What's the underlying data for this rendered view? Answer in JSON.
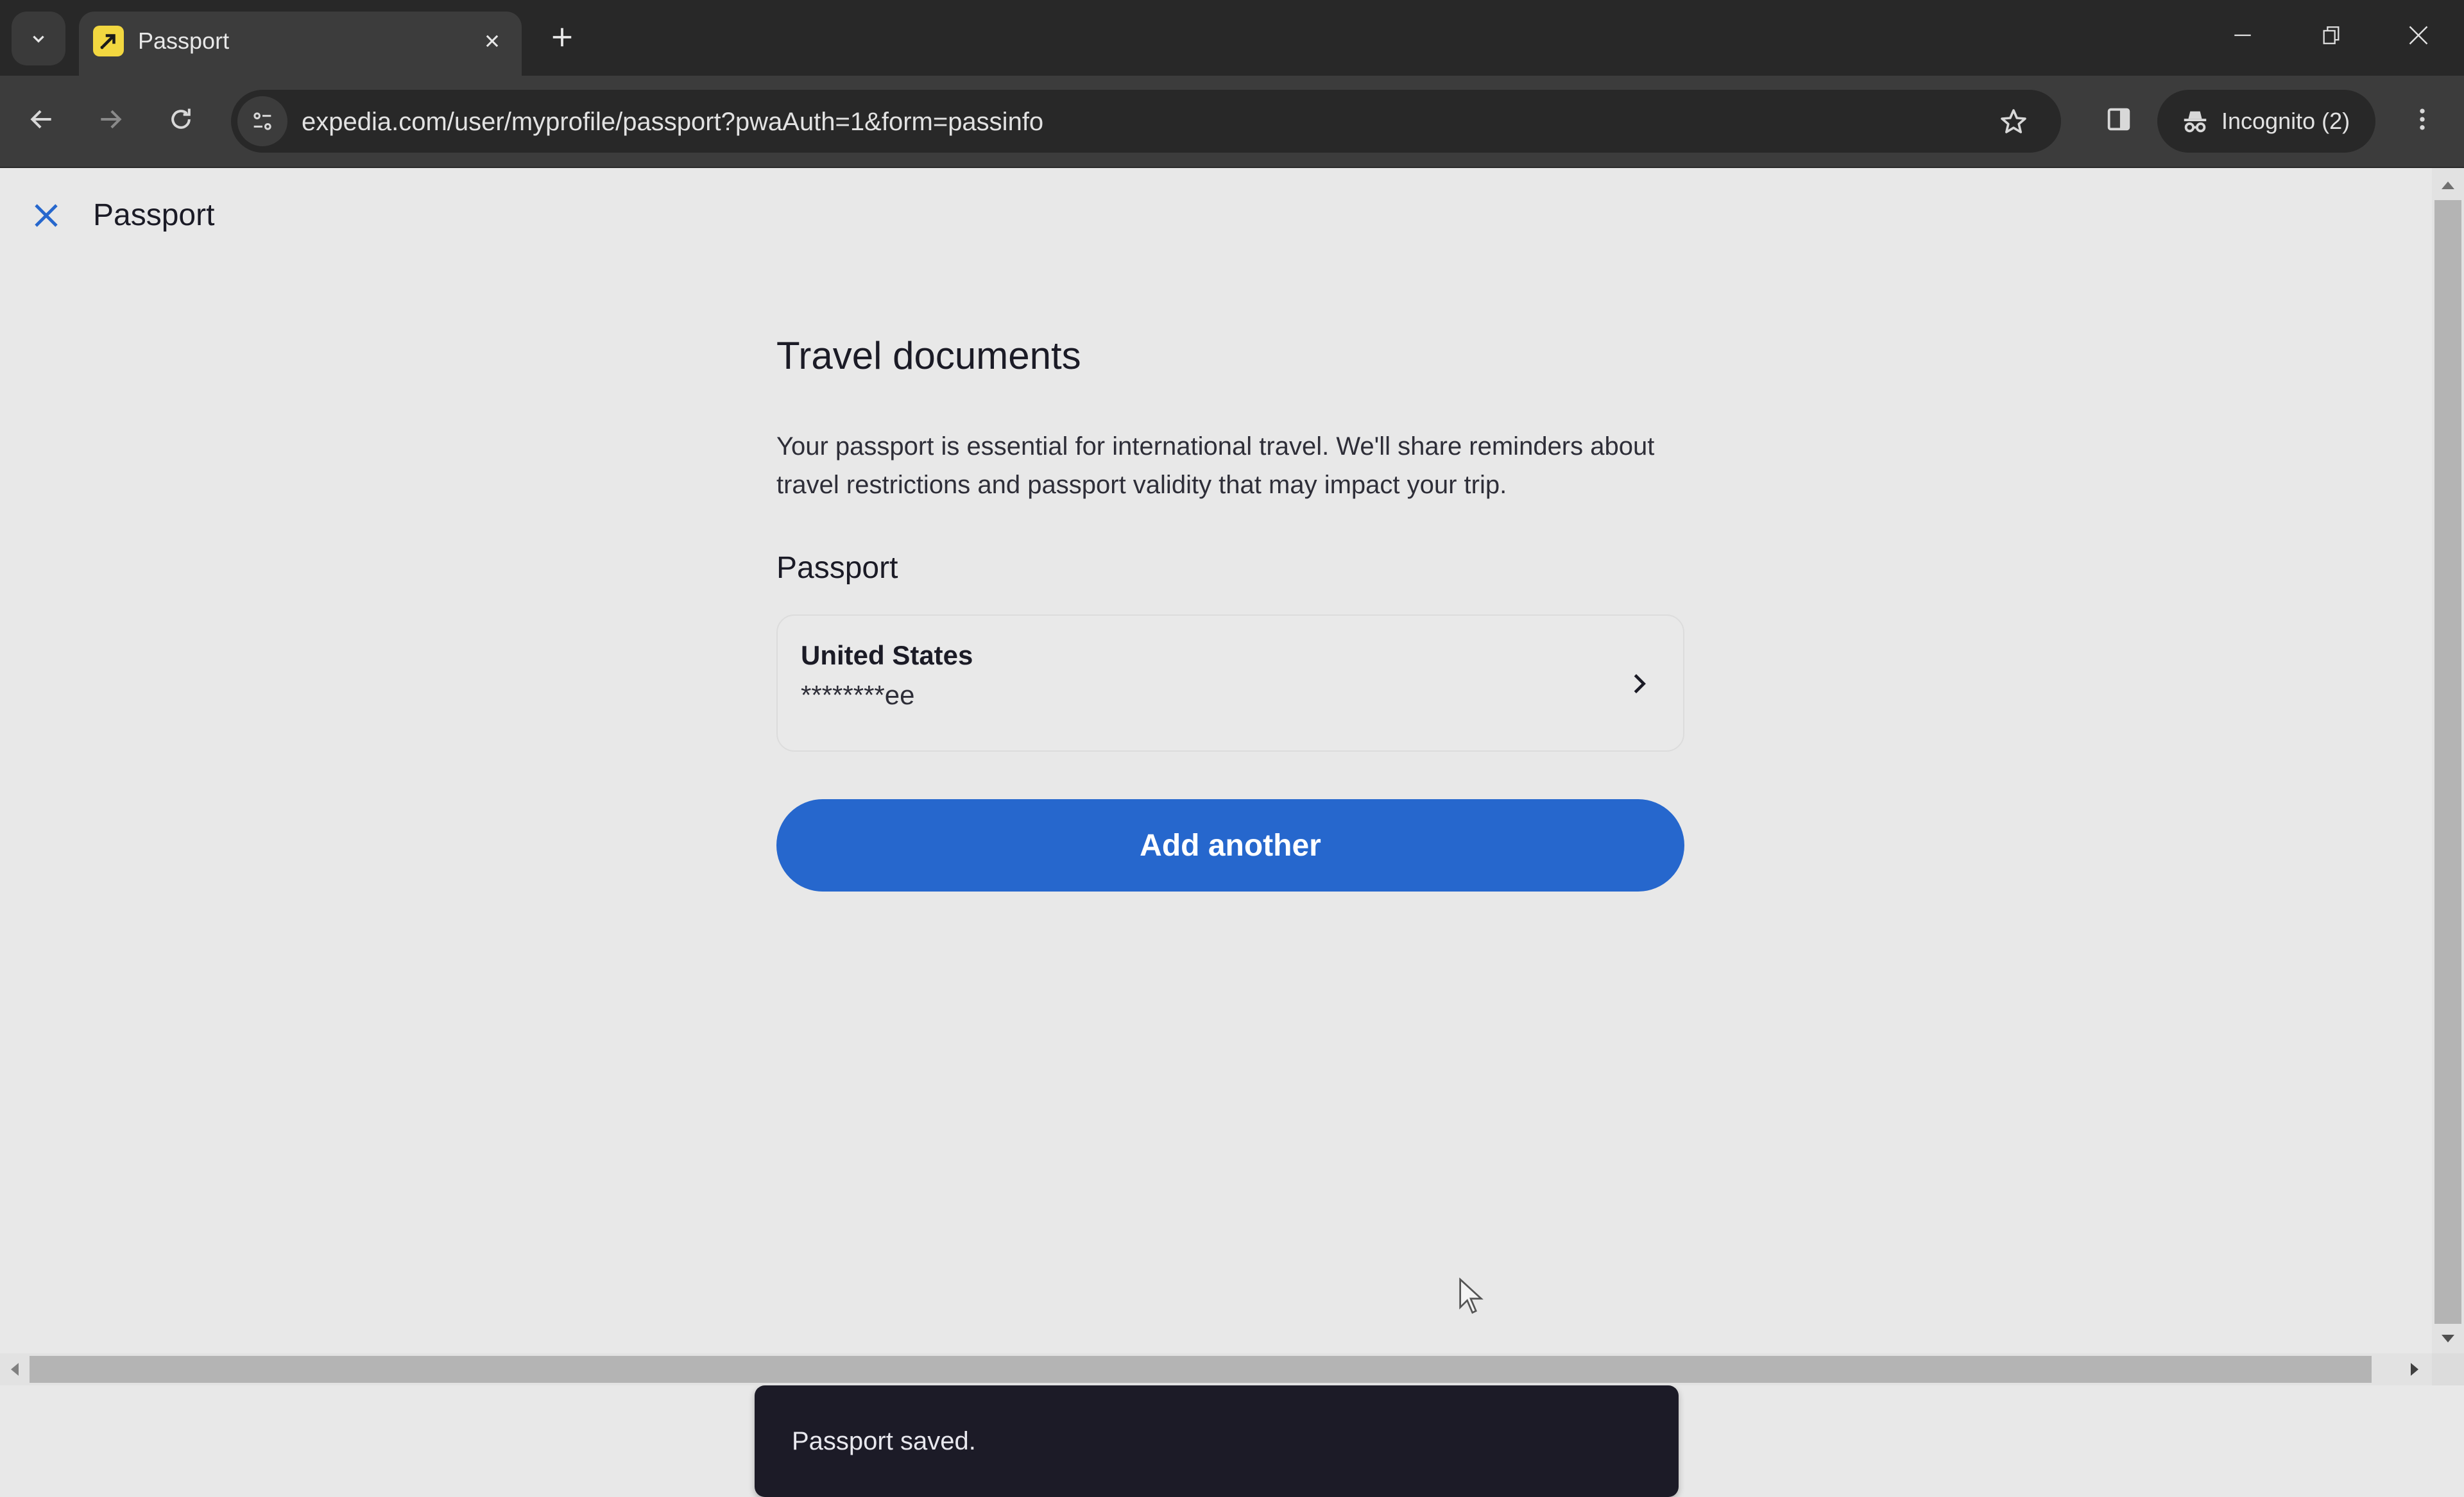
{
  "browser": {
    "tab": {
      "title": "Passport",
      "favicon": "expedia-logo-icon"
    },
    "url": "expedia.com/user/myprofile/passport?pwaAuth=1&form=passinfo",
    "profile_label": "Incognito (2)",
    "icons": {
      "tab_search": "chevron-down-icon",
      "tab_close": "close-icon",
      "new_tab": "plus-icon",
      "back": "arrow-left-icon",
      "forward": "arrow-right-icon",
      "reload": "reload-icon",
      "site_info": "tune-icon",
      "bookmark": "star-icon",
      "side_panel": "side-panel-icon",
      "incognito": "incognito-icon",
      "menu": "kebab-menu-icon",
      "minimize": "minimize-icon",
      "restore": "restore-icon",
      "window_close": "close-icon"
    }
  },
  "page": {
    "header": {
      "title": "Passport",
      "close_icon": "close-icon"
    },
    "heading": "Travel documents",
    "description": "Your passport is essential for international travel. We'll share reminders about travel restrictions and passport validity that may impact your trip.",
    "section_title": "Passport",
    "passports": [
      {
        "country": "United States",
        "number_masked": "********ee"
      }
    ],
    "add_button_label": "Add another",
    "toast_message": "Passport saved.",
    "colors": {
      "primary": "#2667cd",
      "toast_bg": "#1c1b27",
      "text": "#1b1b26",
      "page_bg": "#e8e8e8",
      "favicon_bg": "#f2d740"
    }
  }
}
